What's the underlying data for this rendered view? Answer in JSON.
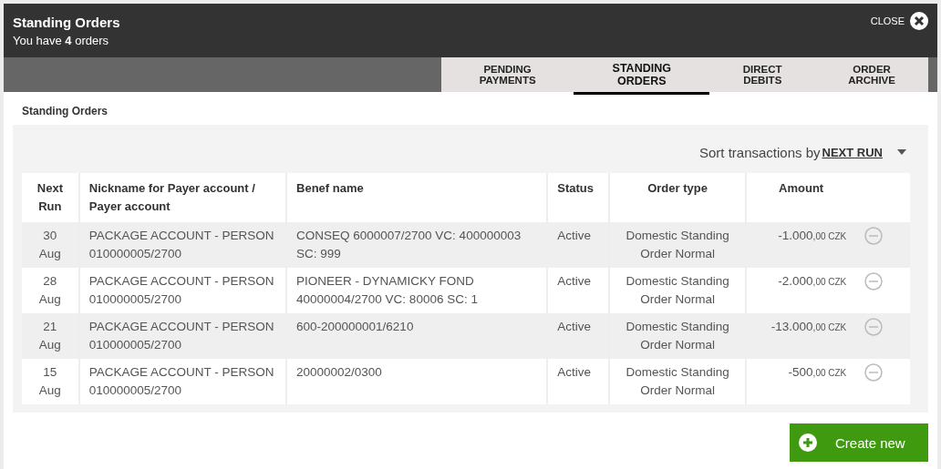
{
  "window": {
    "title": "Standing Orders",
    "subtitle": "You have **4** orders",
    "close": "CLOSE"
  },
  "tabs": [
    {
      "label": "PENDING PAYMENTS",
      "selected": false
    },
    {
      "label": "STANDING ORDERS",
      "selected": true
    },
    {
      "label": "DIRECT DEBITS",
      "selected": false
    },
    {
      "label": "ORDER ARCHIVE",
      "selected": false
    }
  ],
  "section_title": "Standing Orders",
  "sort": {
    "label": "Sort transactions by",
    "value": "NEXT RUN"
  },
  "table": {
    "columns": [
      "Next Run",
      "Nickname for Payer account / Payer account",
      "Benef name",
      "Status",
      "Order type",
      "Amount"
    ],
    "rows": [
      {
        "day": "30",
        "month": "Aug",
        "nickname": "PACKAGE ACCOUNT - PERSON",
        "account": "010000005/2700",
        "benef": "CONSEQ 6000007/2700 VC: 400000003 SC: 999",
        "status": "Active",
        "order_type": "Domestic Standing Order Normal",
        "amount": "-1.000",
        "fraction": ",00",
        "currency": "CZK"
      },
      {
        "day": "28",
        "month": "Aug",
        "nickname": "PACKAGE ACCOUNT - PERSON",
        "account": "010000005/2700",
        "benef": "PIONEER - DYNAMICKY FOND 40000004/2700 VC: 80006 SC: 1",
        "status": "Active",
        "order_type": "Domestic Standing Order Normal",
        "amount": "-2.000",
        "fraction": ",00",
        "currency": "CZK"
      },
      {
        "day": "21",
        "month": "Aug",
        "nickname": "PACKAGE ACCOUNT - PERSON",
        "account": "010000005/2700",
        "benef": "600-200000001/6210",
        "status": "Active",
        "order_type": "Domestic Standing Order Normal",
        "amount": "-13.000",
        "fraction": ",00",
        "currency": "CZK"
      },
      {
        "day": "15",
        "month": "Aug",
        "nickname": "PACKAGE ACCOUNT - PERSON",
        "account": "010000005/2700",
        "benef": "20000002/0300",
        "status": "Active",
        "order_type": "Domestic Standing Order Normal",
        "amount": "-500",
        "fraction": ",00",
        "currency": "CZK"
      }
    ]
  },
  "create_button": "Create new"
}
